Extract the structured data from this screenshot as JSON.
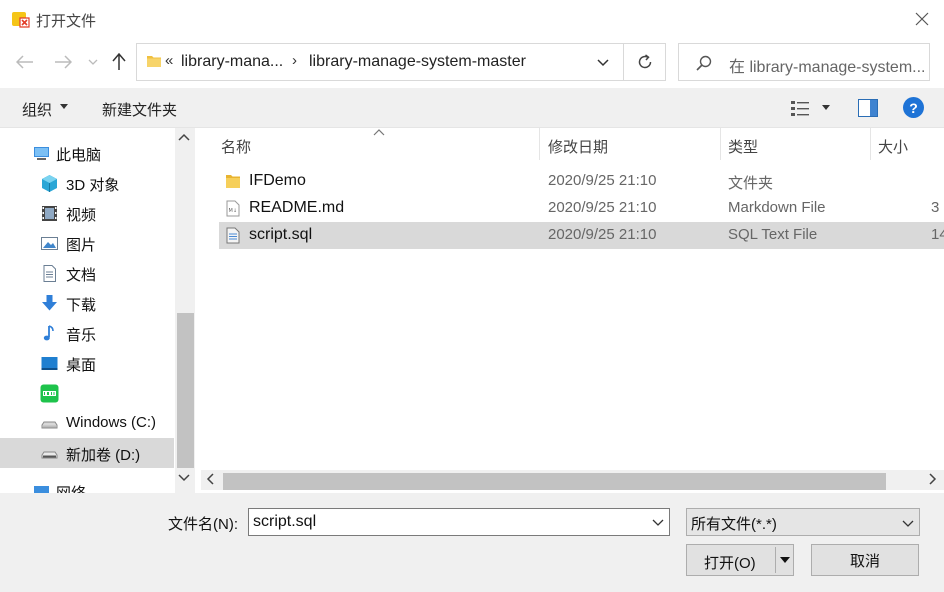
{
  "window": {
    "title": "打开文件"
  },
  "address": {
    "overflow_chevron": "«",
    "segments": [
      "library-mana...",
      "library-manage-system-master"
    ],
    "separator": "›"
  },
  "search": {
    "placeholder": "在 library-manage-system..."
  },
  "toolbar": {
    "organize_label": "组织",
    "new_folder_label": "新建文件夹"
  },
  "nav_pane": {
    "items": [
      {
        "label": "此电脑",
        "icon": "computer-icon"
      },
      {
        "label": "3D 对象",
        "icon": "3d-objects-icon"
      },
      {
        "label": "视频",
        "icon": "video-icon"
      },
      {
        "label": "图片",
        "icon": "pictures-icon"
      },
      {
        "label": "文档",
        "icon": "documents-icon"
      },
      {
        "label": "下载",
        "icon": "download-icon"
      },
      {
        "label": "音乐",
        "icon": "music-icon"
      },
      {
        "label": "桌面",
        "icon": "desktop-icon"
      },
      {
        "label": "",
        "icon": "iqiyi-icon"
      },
      {
        "label": "Windows (C:)",
        "icon": "drive-icon"
      },
      {
        "label": "新加卷 (D:)",
        "icon": "drive-icon"
      },
      {
        "label": "网络",
        "icon": "network-icon"
      }
    ],
    "selected_index": 10
  },
  "file_list": {
    "columns": [
      "名称",
      "修改日期",
      "类型",
      "大小"
    ],
    "rows": [
      {
        "name": "IFDemo",
        "date": "2020/9/25 21:10",
        "type": "文件夹",
        "size": "",
        "icon": "folder-icon"
      },
      {
        "name": "README.md",
        "date": "2020/9/25 21:10",
        "type": "Markdown File",
        "size": "3",
        "icon": "markdown-file-icon"
      },
      {
        "name": "script.sql",
        "date": "2020/9/25 21:10",
        "type": "SQL Text File",
        "size": "14",
        "icon": "sql-file-icon"
      }
    ],
    "selected_index": 2
  },
  "bottom": {
    "filename_label": "文件名(N):",
    "filename_value": "script.sql",
    "filter_label": "所有文件(*.*)",
    "open_label": "打开(O)",
    "cancel_label": "取消"
  },
  "colors": {
    "accent": "#1e73d6",
    "folder": "#f0c040",
    "selection": "#d9d9d9"
  }
}
